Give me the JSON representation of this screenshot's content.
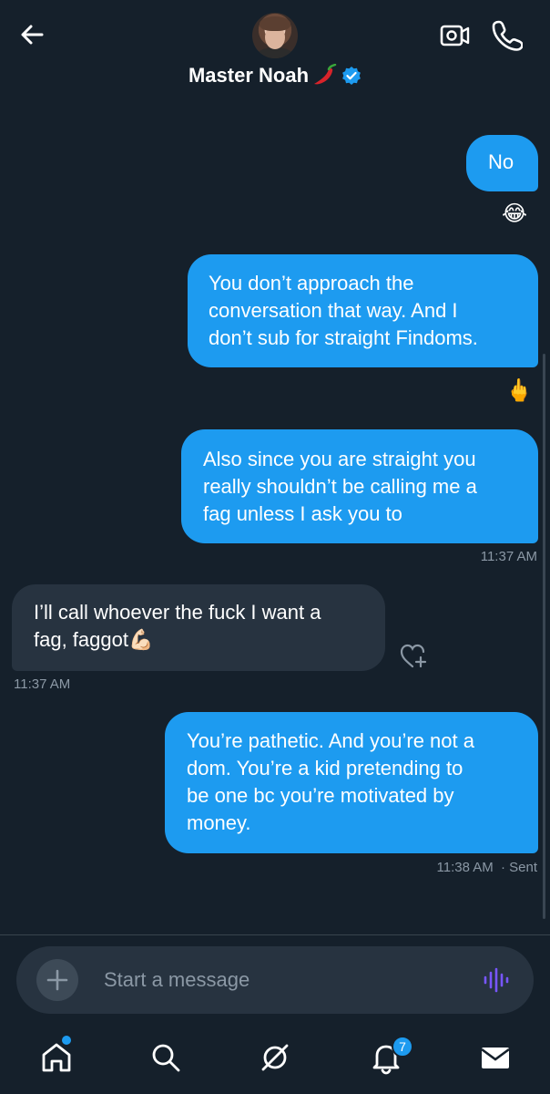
{
  "header": {
    "contact_name": "Master Noah",
    "name_emoji": "🌶️",
    "verified_icon": "verified-badge-icon",
    "back_icon": "arrow-left-icon",
    "video_icon": "video-camera-icon",
    "phone_icon": "phone-icon"
  },
  "messages": [
    {
      "direction": "outgoing",
      "text": "No"
    },
    {
      "reaction": "😂"
    },
    {
      "direction": "outgoing",
      "lines": [
        "You don’t approach the",
        "conversation that way. And I",
        "don’t sub for straight Findoms."
      ]
    },
    {
      "reaction": "🖕"
    },
    {
      "direction": "outgoing",
      "lines": [
        "Also since you are straight you",
        "really shouldn’t be calling me a",
        "fag unless I ask you to"
      ],
      "timestamp": "11:37 AM"
    },
    {
      "direction": "incoming",
      "lines": [
        "I’ll call whoever the fuck I want a",
        "fag, faggot💪🏻"
      ],
      "timestamp": "11:37 AM"
    },
    {
      "direction": "outgoing",
      "lines": [
        "You’re pathetic. And you’re not a",
        "dom. You’re a kid pretending to",
        "be one bc you’re motivated by",
        "money."
      ],
      "timestamp": "11:38 AM",
      "status": "· Sent"
    }
  ],
  "composer": {
    "placeholder": "Start a message",
    "add_icon": "plus-icon",
    "voice_icon": "voice-waveform-icon"
  },
  "tabs": [
    {
      "name": "home-icon"
    },
    {
      "name": "search-icon"
    },
    {
      "name": "grok-icon"
    },
    {
      "name": "bell-icon",
      "badge": "7"
    },
    {
      "name": "mail-icon"
    }
  ],
  "colors": {
    "background": "#15202b",
    "outgoing_bubble": "#1d9bf0",
    "incoming_bubble": "#273340",
    "muted_text": "#8b98a5",
    "voice_accent": "#7856ff"
  }
}
